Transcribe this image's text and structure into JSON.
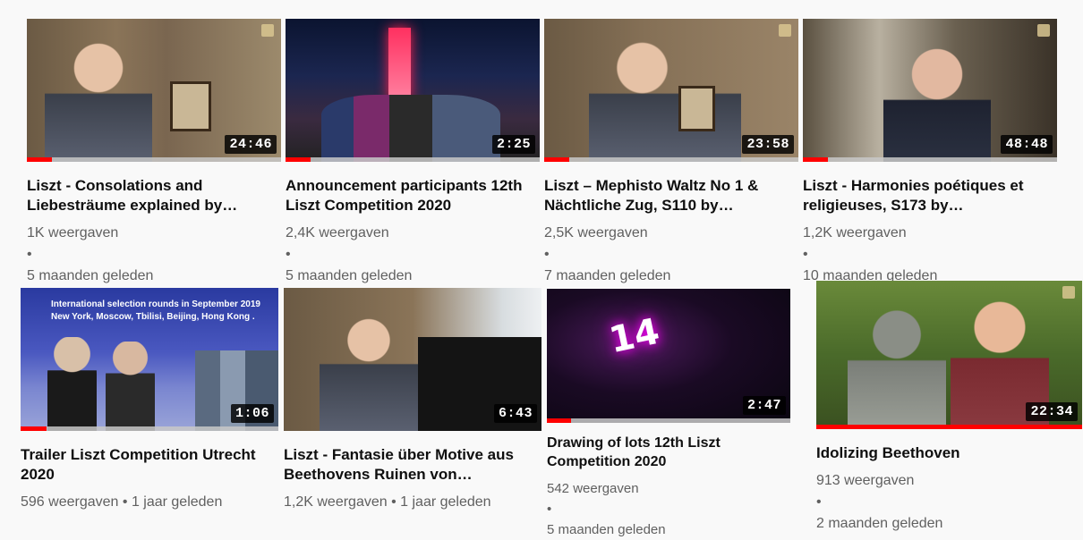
{
  "videos": [
    {
      "title": "Liszt - Consolations and Liebesträume explained by…",
      "duration": "24:46",
      "views": "1K weergaven",
      "age": "5 maanden geleden",
      "progress": 0.1
    },
    {
      "title": "Announcement participants 12th Liszt Competition 2020",
      "duration": "2:25",
      "views": "2,4K weergaven",
      "age": "5 maanden geleden",
      "progress": 0.1
    },
    {
      "title": "Liszt – Mephisto Waltz No 1 & Nächtliche Zug, S110 by…",
      "duration": "23:58",
      "views": "2,5K weergaven",
      "age": "7 maanden geleden",
      "progress": 0.1
    },
    {
      "title": "Liszt - Harmonies poétiques et religieuses, S173 by…",
      "duration": "48:48",
      "views": "1,2K weergaven",
      "age": "10 maanden geleden",
      "progress": 0.1
    },
    {
      "title": "Trailer Liszt Competition Utrecht 2020",
      "duration": "1:06",
      "views": "596 weergaven",
      "age": "1 jaar geleden",
      "progress": 0.1,
      "overlay_line1": "International selection rounds in September 2019",
      "overlay_line2": "New York, Moscow, Tbilisi, Beijing, Hong Kong ."
    },
    {
      "title": "Liszt - Fantasie über Motive aus Beethovens Ruinen von…",
      "duration": "6:43",
      "views": "1,2K weergaven",
      "age": "1 jaar geleden",
      "progress": 0.0
    },
    {
      "title": "Drawing of lots 12th Liszt Competition 2020",
      "duration": "2:47",
      "views": "542 weergaven",
      "age": "5 maanden geleden",
      "progress": 0.1,
      "overlay_number": "14"
    },
    {
      "title": "Idolizing Beethoven",
      "duration": "22:34",
      "views": "913 weergaven",
      "age": "2 maanden geleden",
      "progress": 1.0
    }
  ],
  "separator": "•",
  "colors": {
    "progress": "#ff0000",
    "background": "#f9f9f9",
    "meta_text": "#606060"
  }
}
